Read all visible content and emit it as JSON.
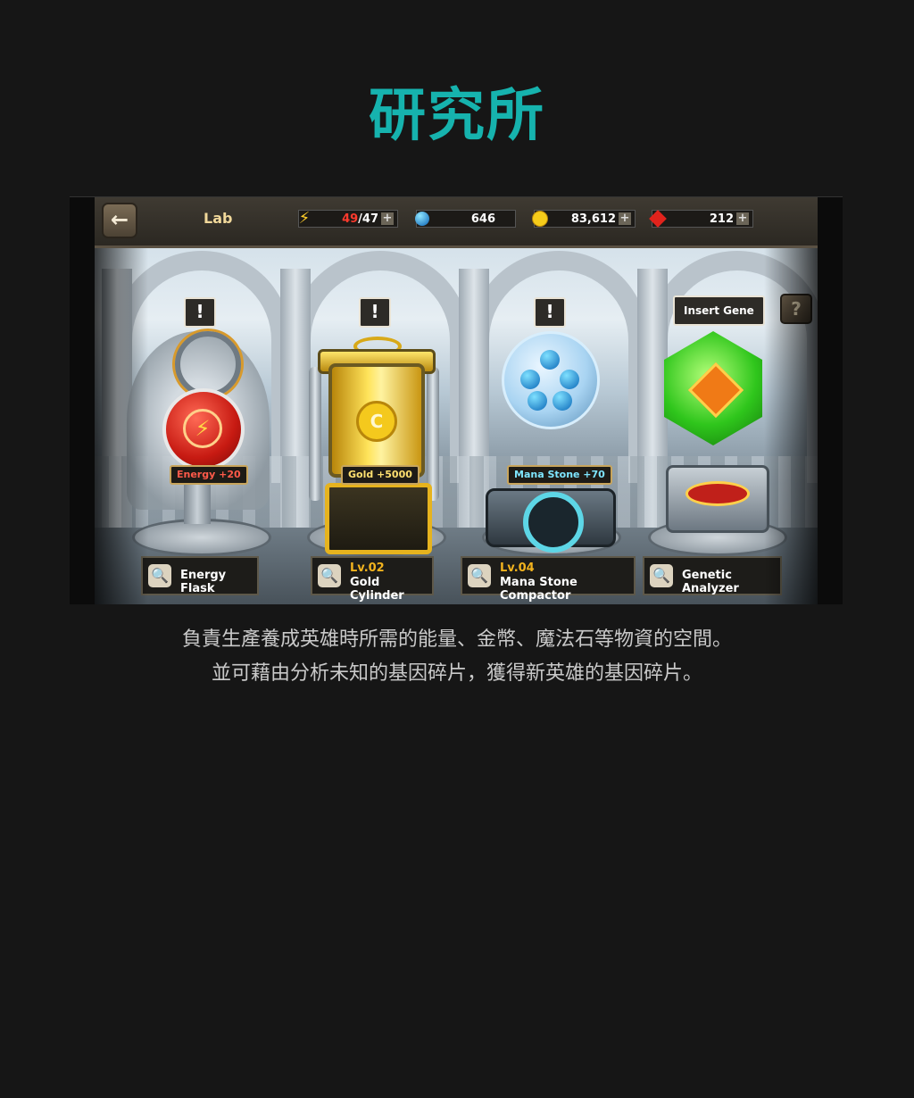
{
  "page": {
    "title": "研究所"
  },
  "topbar": {
    "screen_label": "Lab",
    "energy_current": "49",
    "energy_max": "/47",
    "mana_stone": "646",
    "gold": "83,612",
    "ruby": "212",
    "plus_symbol": "+"
  },
  "lab": {
    "alert_symbol": "!",
    "insert_gene_label": "Insert Gene",
    "help_symbol": "?",
    "machines": [
      {
        "name": "Energy Flask",
        "level": "",
        "bonus": "Energy +20",
        "bonus_color": "#ff5a4a"
      },
      {
        "name": "Gold Cylinder",
        "level": "Lv.02",
        "bonus": "Gold +5000",
        "bonus_color": "#ffe070"
      },
      {
        "name": "Mana Stone Compactor",
        "level": "Lv.04",
        "bonus": "Mana Stone +70",
        "bonus_color": "#7fe6ff"
      },
      {
        "name": "Genetic Analyzer",
        "level": "",
        "bonus": "",
        "bonus_color": "#ffffff"
      }
    ]
  },
  "description": {
    "line1": "負責生產養成英雄時所需的能量、金幣、魔法石等物資的空間。",
    "line2": "並可藉由分析未知的基因碎片，獲得新英雄的基因碎片。"
  },
  "colors": {
    "title": "#16b3ae",
    "accent_gold": "#f2b31e"
  },
  "icons": [
    "back-arrow-icon",
    "lightning-icon",
    "mana-orb-icon",
    "gold-coin-icon",
    "ruby-icon",
    "magnifier-icon"
  ]
}
